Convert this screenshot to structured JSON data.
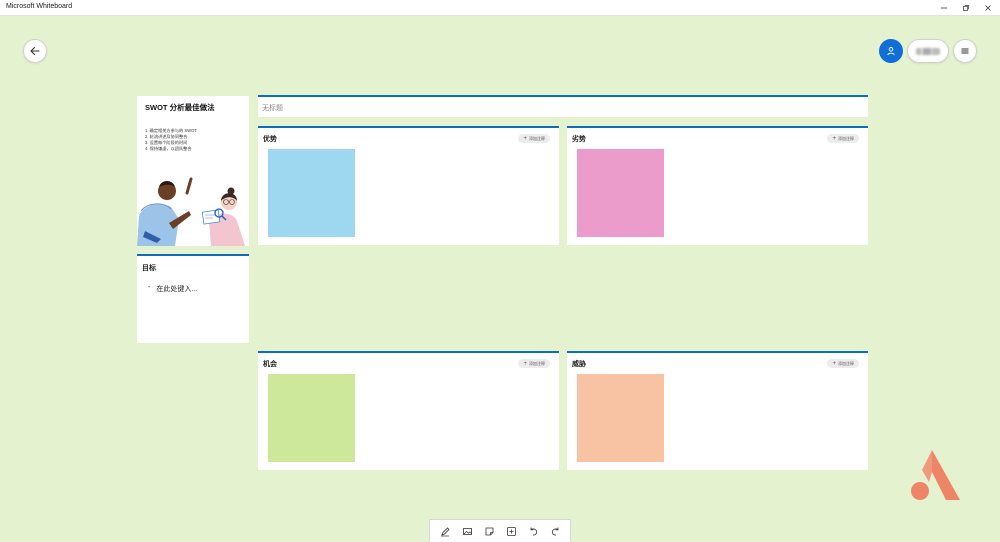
{
  "app": {
    "title": "Microsoft Whiteboard"
  },
  "guide": {
    "title": "SWOT 分析最佳做法",
    "steps": [
      "1. 确定相关方参与的 SWOT",
      "2. 轮流讲述及协同整合",
      "3. 设置每个阶段的时间",
      "4. 保持谦虚，以团队整合"
    ]
  },
  "goal": {
    "title": "目标",
    "bullet": "-",
    "placeholder": "在此处键入..."
  },
  "board": {
    "title_placeholder": "无标题"
  },
  "quadrants": {
    "strength": {
      "title": "优势",
      "add_label": "添加注释",
      "note_color": "#9dd8f0"
    },
    "weakness": {
      "title": "劣势",
      "add_label": "添加注释",
      "note_color": "#ec9ccb"
    },
    "opportunity": {
      "title": "机会",
      "add_label": "添加注释",
      "note_color": "#cde79b"
    },
    "threat": {
      "title": "威胁",
      "add_label": "添加注释",
      "note_color": "#f8c3a2"
    }
  },
  "icons": {
    "back": "arrow-left-icon",
    "menu": "hamburger-icon",
    "avatar": "person-icon",
    "toolbar": [
      "pen-icon",
      "image-icon",
      "note-icon",
      "add-icon",
      "undo-icon",
      "redo-icon"
    ]
  },
  "colors": {
    "canvas": "#e5f2cf",
    "accent": "#0f6cbd",
    "avatar": "#0f6fd6",
    "logo": "#ee8566"
  }
}
